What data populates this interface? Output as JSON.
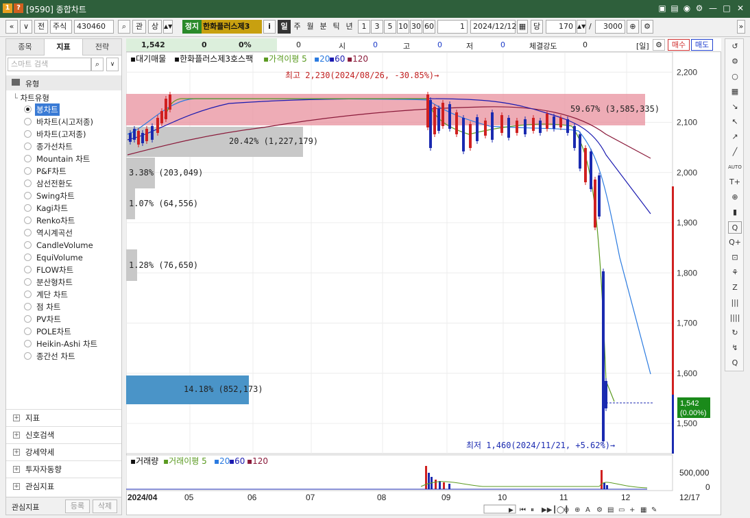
{
  "titlebar": {
    "badge1": "1",
    "badge2": "?",
    "title": "[9590] 종합차트",
    "buttons": [
      "▣",
      "▤",
      "◉",
      "⚙",
      "—",
      "□",
      "✕"
    ]
  },
  "toolbar": {
    "nav_prev": "«",
    "nav_down": "∨",
    "front": "전",
    "market_select": "주식",
    "code": "430460",
    "search_btn": "⌕",
    "interest_btn": "관",
    "sangseung_btn": "상",
    "stop_badge": "정지",
    "stock_name": "한화플러스제3",
    "info_btn": "i",
    "periods": [
      "일",
      "주",
      "월",
      "분",
      "틱",
      "년"
    ],
    "numbers": [
      "1",
      "3",
      "5",
      "10",
      "30",
      "60"
    ],
    "count_value": "1",
    "date": "2024/12/12",
    "dang": "당",
    "qty": "170",
    "slash": "/",
    "total": "3000"
  },
  "leftpanel": {
    "tabs": [
      "종목",
      "지표",
      "전략"
    ],
    "active_tab": 1,
    "search_placeholder": "스마트 검색",
    "section_title": "유형",
    "group_title": "차트유형",
    "chart_types": [
      "봉차트",
      "바차트(시고저종)",
      "바차트(고저종)",
      "종가선차트",
      "Mountain 차트",
      "P&F차트",
      "삼선전환도",
      "Swing차트",
      "Kagi차트",
      "Renko차트",
      "역시계곡선",
      "CandleVolume",
      "EquiVolume",
      "FLOW차트",
      "분산형차트",
      "계단 차트",
      "점 차트",
      "PV차트",
      "POLE차트",
      "Heikin-Ashi 차트",
      "종간선 차트"
    ],
    "selected": 0,
    "accordion": [
      "지표",
      "신호검색",
      "강세약세",
      "투자자동향",
      "관심지표"
    ],
    "footer_title": "관심지표",
    "footer_btns": [
      "등록",
      "삭제"
    ]
  },
  "infobar": {
    "price": "1,542",
    "change": "0",
    "rate": "0%",
    "volume": "0",
    "open_label": "시",
    "open": "0",
    "high_label": "고",
    "high": "0",
    "low_label": "저",
    "low": "0",
    "strength_label": "체결강도",
    "strength": "0",
    "period_label": "[일]",
    "buy": "매수",
    "sell": "매도"
  },
  "legend": {
    "pending": "대기매물",
    "stock": "한화플러스제3호스팩",
    "ma_label": "가격이평 5",
    "ma": [
      "20",
      "60",
      "120"
    ],
    "vol_label": "거래량",
    "vma_label": "거래이평 5"
  },
  "annotations": {
    "high": "최고 2,230(2024/08/26, -30.85%)→",
    "low": "최저 1,460(2024/11/21, +5.62%)→",
    "current_price": "1,542",
    "current_rate": "(0.00%)"
  },
  "volume_profile": [
    {
      "label": "59.67% (3,585,335)",
      "color": "#e8909e"
    },
    {
      "label": "20.42% (1,227,179)",
      "color": "#c8c8c8"
    },
    {
      "label": "3.38% (203,049)",
      "color": "#c8c8c8"
    },
    {
      "label": "1.07% (64,556)",
      "color": "#c8c8c8"
    },
    {
      "label": "1.28% (76,650)",
      "color": "#c8c8c8"
    },
    {
      "label": "14.18% (852,173)",
      "color": "#4a94c8"
    }
  ],
  "axis": {
    "y_ticks": [
      "2,200",
      "2,100",
      "2,000",
      "1,900",
      "1,800",
      "1,700",
      "1,600",
      "1,500"
    ],
    "vol_ticks": [
      "500,000",
      "0"
    ],
    "x_ticks": [
      "2024/04",
      "05",
      "06",
      "07",
      "08",
      "09",
      "10",
      "11",
      "12"
    ],
    "x_end": "12/17"
  },
  "chart_data": {
    "type": "candlestick",
    "ylim": [
      1440,
      2240
    ],
    "high": 2230,
    "low": 1460,
    "last": 1542
  },
  "right_tools": [
    "↺",
    "⚙",
    "○",
    "▦",
    "↘",
    "↖",
    "↗",
    "╱",
    "AUTO",
    "T+",
    "⊕",
    "▮",
    "Q",
    "Q+",
    "⊡",
    "⚘",
    "Z",
    "|||",
    "||||",
    "↻",
    "↯",
    "Q"
  ]
}
